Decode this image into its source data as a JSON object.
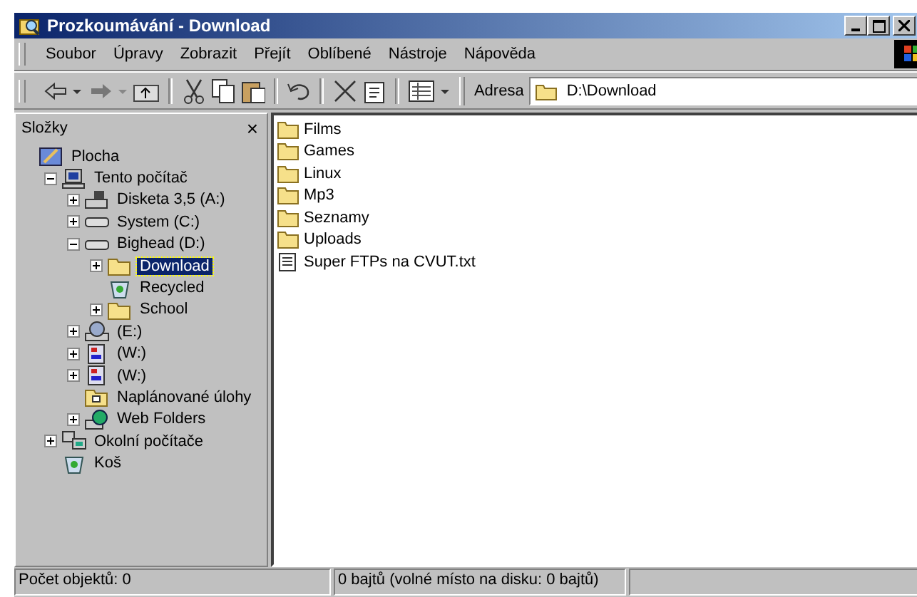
{
  "window": {
    "title": "Prozkoumávání - Download"
  },
  "menu": [
    "Soubor",
    "Úpravy",
    "Zobrazit",
    "Přejít",
    "Oblíbené",
    "Nástroje",
    "Nápověda"
  ],
  "address": {
    "label": "Adresa",
    "value": "D:\\Download"
  },
  "folders_pane": {
    "title": "Složky",
    "close": "×"
  },
  "tree": [
    {
      "label": "Plocha",
      "kind": "desktop",
      "selected": false,
      "children": [
        {
          "label": "Tento počítač",
          "kind": "computer",
          "expanded": true,
          "selected": false,
          "children": [
            {
              "label": "Disketa 3,5 (A:)",
              "kind": "floppy",
              "expanded": false,
              "selected": false
            },
            {
              "label": "System (C:)",
              "kind": "drive",
              "expanded": false,
              "selected": false
            },
            {
              "label": "Bighead (D:)",
              "kind": "drive",
              "expanded": true,
              "selected": false,
              "children": [
                {
                  "label": "Download",
                  "kind": "folder",
                  "expanded": false,
                  "selected": true
                },
                {
                  "label": "Recycled",
                  "kind": "recycle",
                  "selected": false
                },
                {
                  "label": "School",
                  "kind": "folder",
                  "expanded": false,
                  "selected": false
                }
              ]
            },
            {
              "label": "(E:)",
              "kind": "cdrom",
              "expanded": false,
              "selected": false
            },
            {
              "label": "(W:)",
              "kind": "netdrive",
              "expanded": false,
              "selected": false
            },
            {
              "label": "(W:)",
              "kind": "netdrive",
              "expanded": false,
              "selected": false
            },
            {
              "label": "Naplánované úlohy",
              "kind": "tasks",
              "selected": false
            },
            {
              "label": "Web Folders",
              "kind": "web",
              "expanded": false,
              "selected": false
            }
          ]
        },
        {
          "label": "Okolní počítače",
          "kind": "network",
          "expanded": false,
          "selected": false
        },
        {
          "label": "Koš",
          "kind": "recycle",
          "selected": false
        }
      ]
    }
  ],
  "files": [
    {
      "name": "Films",
      "kind": "folder"
    },
    {
      "name": "Games",
      "kind": "folder"
    },
    {
      "name": "Linux",
      "kind": "folder"
    },
    {
      "name": "Mp3",
      "kind": "folder"
    },
    {
      "name": "Seznamy",
      "kind": "folder"
    },
    {
      "name": "Uploads",
      "kind": "folder"
    },
    {
      "name": "Super FTPs na CVUT.txt",
      "kind": "text"
    }
  ],
  "status_bar": [
    "Počet objektů: 0",
    "0 bajtů (volné místo na disku: 0 bajtů)"
  ]
}
